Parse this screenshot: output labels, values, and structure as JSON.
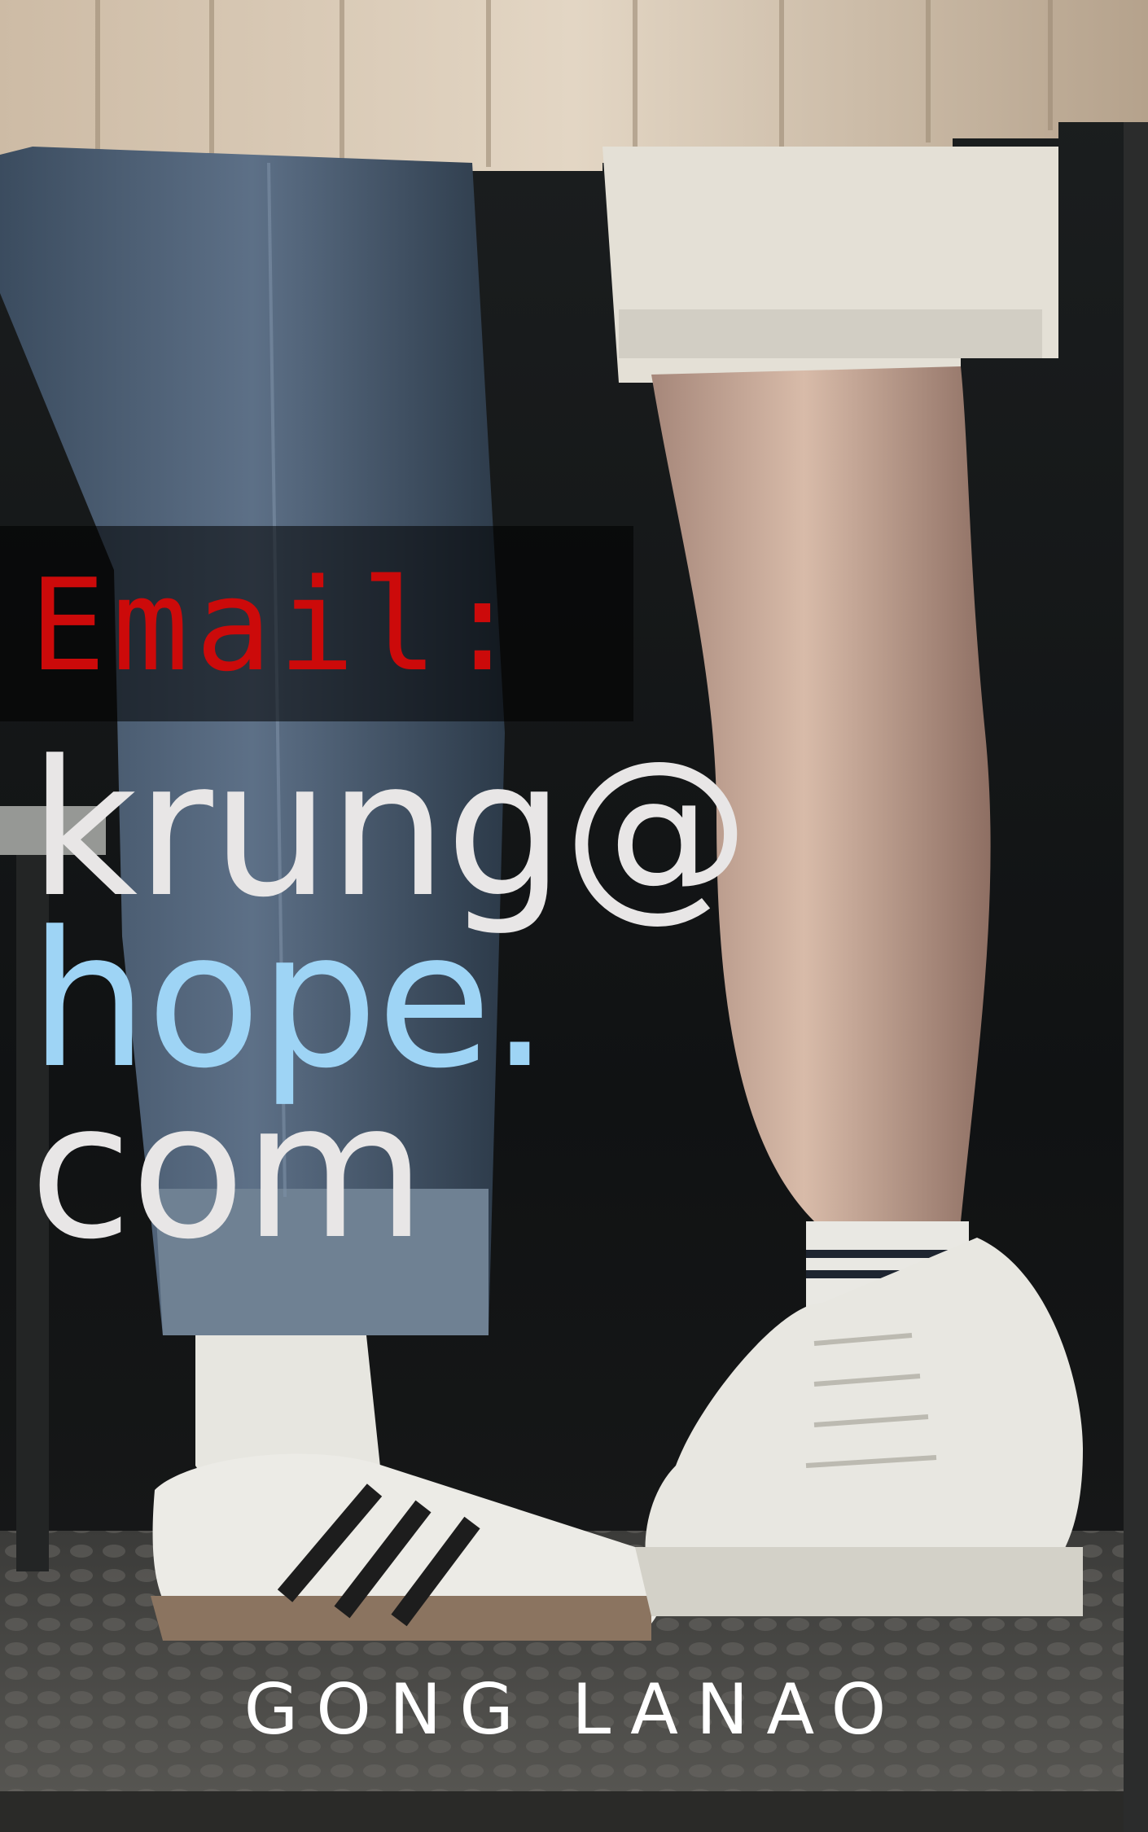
{
  "cover": {
    "label": "Email:",
    "email_lines": [
      "krung@",
      "hope.",
      "com"
    ],
    "author": "GONG LANAO"
  },
  "colors": {
    "label": "#cc0a0a",
    "email_primary": "#e8e6e6",
    "email_accent": "#9ed4f5",
    "author": "#ffffff",
    "background": "#141617"
  },
  "icons": {
    "photo": "legs-and-sneakers-photo"
  }
}
